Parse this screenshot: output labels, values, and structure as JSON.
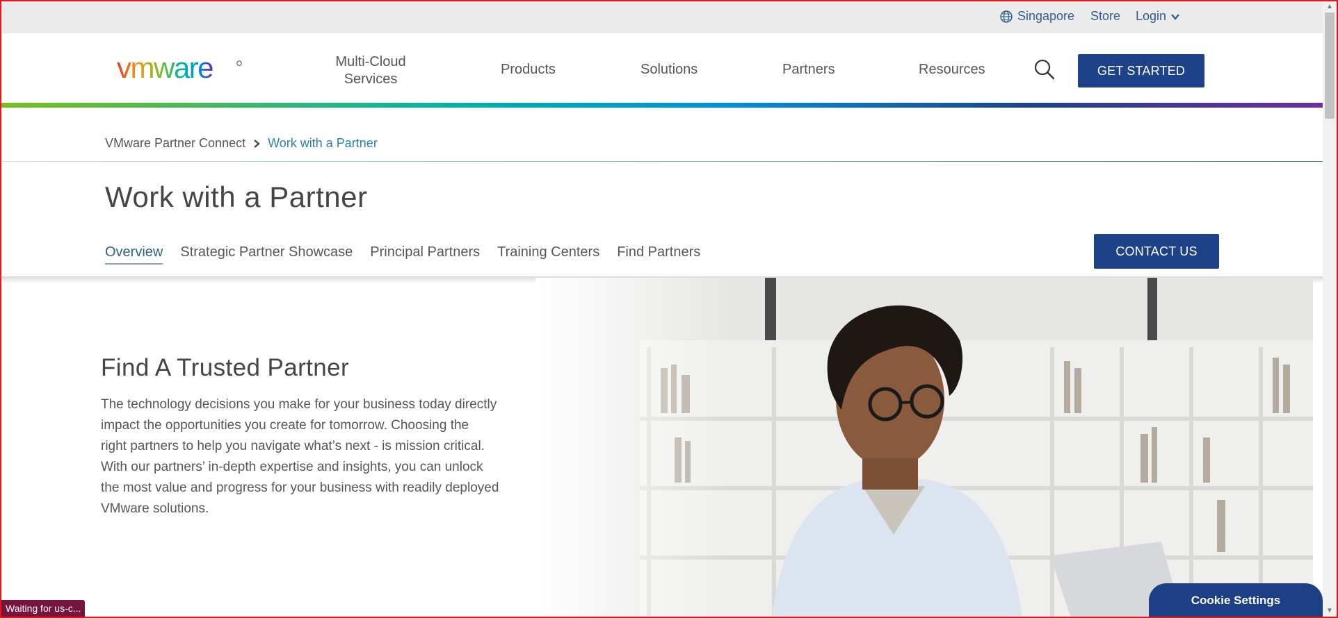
{
  "utility": {
    "region": "Singapore",
    "store": "Store",
    "login": "Login"
  },
  "nav": {
    "logo_text": "vmware",
    "multi_cloud_line1": "Multi-Cloud",
    "multi_cloud_line2": "Services",
    "products": "Products",
    "solutions": "Solutions",
    "partners": "Partners",
    "resources": "Resources",
    "get_started": "GET STARTED"
  },
  "breadcrumb": {
    "home": "VMware Partner Connect",
    "current": "Work with a Partner"
  },
  "page": {
    "title": "Work with a Partner",
    "tabs": [
      {
        "label": "Overview",
        "active": true
      },
      {
        "label": "Strategic Partner Showcase"
      },
      {
        "label": "Principal Partners"
      },
      {
        "label": "Training Centers"
      },
      {
        "label": "Find Partners"
      }
    ],
    "contact_us": "CONTACT US"
  },
  "hero": {
    "title": "Find A Trusted Partner",
    "body_lines": [
      "The technology decisions you make for your business today directly",
      "impact the opportunities you create for tomorrow. Choosing the",
      "right partners to help you navigate what’s next - is mission critical.",
      "With our partners’ in-depth expertise and insights, you can unlock",
      "the most value and progress for your business with readily deployed",
      "VMware solutions."
    ]
  },
  "status": "Waiting for us-c...",
  "cookie_settings": "Cookie Settings",
  "colors": {
    "brand_blue": "#1d428a",
    "link_blue": "#2d7fb3",
    "utility_bg": "#ebebeb",
    "status_bg": "#75143c"
  }
}
